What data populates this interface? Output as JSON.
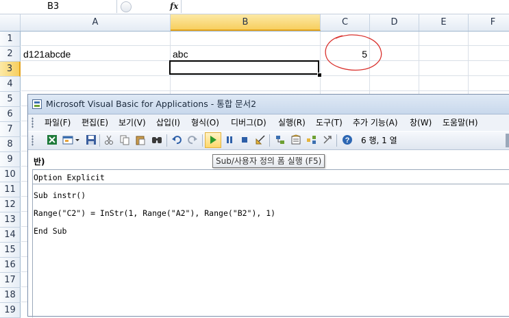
{
  "formula_bar": {
    "name_box": "B3",
    "fx_label": "fx",
    "formula": ""
  },
  "columns": [
    "A",
    "B",
    "C",
    "D",
    "E",
    "F"
  ],
  "selected_column": "B",
  "rows": [
    "1",
    "2",
    "3",
    "4",
    "5",
    "6",
    "7",
    "8",
    "9",
    "10",
    "11",
    "12",
    "13",
    "14",
    "15",
    "16",
    "17",
    "18",
    "19"
  ],
  "selected_row": "3",
  "cells": {
    "A2": "d121abcde",
    "B2": "abc",
    "C2": "5"
  },
  "active_cell": "B3",
  "annotation": {
    "shape": "hand-drawn-circle",
    "around": "C2",
    "color": "#d9302c"
  },
  "vba_window": {
    "title": "Microsoft Visual Basic for Applications - 통합 문서2",
    "menus": [
      "파일(F)",
      "편집(E)",
      "보기(V)",
      "삽입(I)",
      "형식(O)",
      "디버그(D)",
      "실행(R)",
      "도구(T)",
      "추가 기능(A)",
      "창(W)",
      "도움말(H)"
    ],
    "toolbar": {
      "icons": [
        "excel-icon",
        "insert-userform-icon",
        "dropdown-arrow-icon",
        "save-icon",
        "cut-icon",
        "copy-icon",
        "paste-icon",
        "find-icon",
        "undo-icon",
        "redo-icon",
        "run-icon",
        "break-icon",
        "reset-icon",
        "design-mode-icon",
        "project-explorer-icon",
        "properties-icon",
        "object-browser-icon",
        "toolbox-icon",
        "help-icon"
      ],
      "position": "6 행, 1 열"
    },
    "tooltip": "Sub/사용자 정의 폼 실행 (F5)",
    "code_header_fragment": "반)",
    "code_lines": [
      "Option Explicit",
      "",
      "Sub instr()",
      "",
      "Range(\"C2\") = InStr(1, Range(\"A2\"), Range(\"B2\"), 1)",
      "",
      "End Sub"
    ]
  },
  "colors": {
    "selection_header": "#f7cf5f",
    "title_bar": "#c8d8ec",
    "annotation": "#d9302c"
  }
}
